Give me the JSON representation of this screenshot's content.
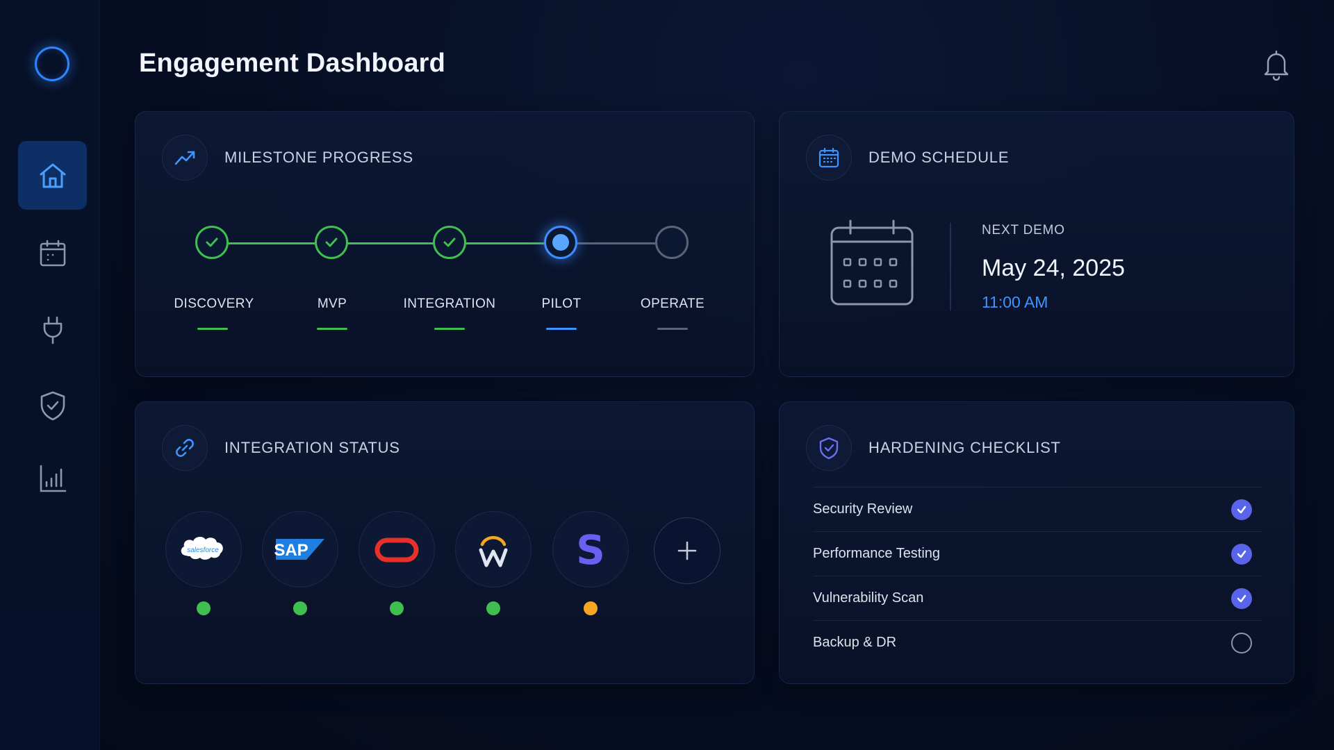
{
  "header": {
    "title": "Engagement Dashboard"
  },
  "sidebar": {
    "items": [
      {
        "icon": "home-icon",
        "active": true
      },
      {
        "icon": "calendar-icon",
        "active": false
      },
      {
        "icon": "plug-icon",
        "active": false
      },
      {
        "icon": "shield-check-icon",
        "active": false
      },
      {
        "icon": "bar-chart-icon",
        "active": false
      }
    ]
  },
  "milestone": {
    "title": "MILESTONE PROGRESS",
    "stages": [
      {
        "label": "DISCOVERY",
        "state": "done"
      },
      {
        "label": "MVP",
        "state": "done"
      },
      {
        "label": "INTEGRATION",
        "state": "done"
      },
      {
        "label": "PILOT",
        "state": "current"
      },
      {
        "label": "OPERATE",
        "state": "todo"
      }
    ]
  },
  "demo": {
    "title": "DEMO SCHEDULE",
    "next_label": "NEXT DEMO",
    "date": "May 24, 2025",
    "time": "11:00 AM"
  },
  "integration": {
    "title": "INTEGRATION STATUS",
    "items": [
      {
        "name": "salesforce",
        "status": "connected"
      },
      {
        "name": "SAP",
        "status": "connected"
      },
      {
        "name": "oracle",
        "status": "connected"
      },
      {
        "name": "workday",
        "status": "connected"
      },
      {
        "name": "stripe",
        "status": "pending"
      }
    ]
  },
  "hardening": {
    "title": "HARDENING CHECKLIST",
    "items": [
      {
        "label": "Security Review",
        "checked": true
      },
      {
        "label": "Performance Testing",
        "checked": true
      },
      {
        "label": "Vulnerability Scan",
        "checked": true
      },
      {
        "label": "Backup & DR",
        "checked": false
      }
    ]
  },
  "colors": {
    "accent": "#3e95ff",
    "success": "#3fbf4f",
    "warning": "#f5a623",
    "check": "#5a64e8"
  }
}
